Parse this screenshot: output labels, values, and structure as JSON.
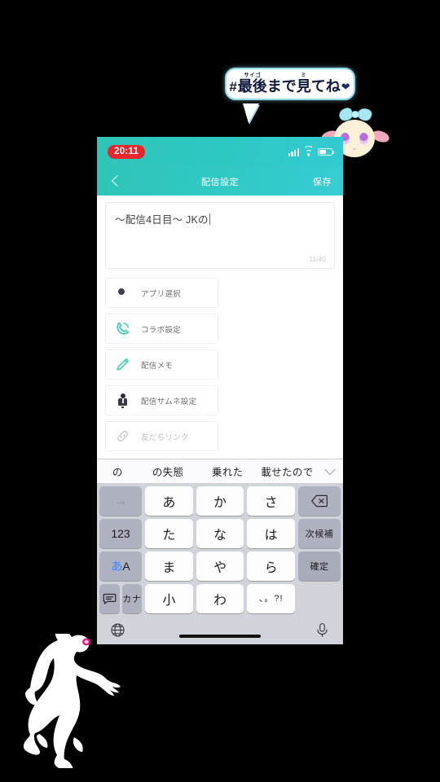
{
  "overlay": {
    "bubble": {
      "hash": "#",
      "ruby1_text": "サイゴ",
      "base1": "最後",
      "mid": "まで",
      "ruby2_text": "ミ",
      "base2": "見",
      "tail_text": "てね",
      "heart": "❤"
    },
    "mascot_name": "sheep-mascot",
    "dancer_name": "dancing-silhouette"
  },
  "phone": {
    "statusbar": {
      "time": "20:11",
      "signal_icon": "signal-bars-icon",
      "wifi_icon": "wifi-icon",
      "battery_icon": "battery-icon"
    },
    "navbar": {
      "back_icon": "chevron-left-icon",
      "title": "配信設定",
      "save_label": "保存"
    },
    "title_input": {
      "value": "〜配信4日目〜 JKの",
      "counter": "11/40"
    },
    "menu": [
      {
        "label": "アプリ選択",
        "icon": "app-select-icon",
        "dim": false
      },
      {
        "label": "コラボ設定",
        "icon": "phone-collab-icon",
        "dim": false
      },
      {
        "label": "配信メモ",
        "icon": "pencil-memo-icon",
        "dim": false
      },
      {
        "label": "配信サムネ設定",
        "icon": "thumbnail-person-icon",
        "dim": false
      },
      {
        "label": "友だちリンク",
        "icon": "link-chain-icon",
        "dim": true
      }
    ]
  },
  "keyboard": {
    "suggestions": [
      {
        "text": "の",
        "wide": false
      },
      {
        "text": "の失態",
        "wide": true
      },
      {
        "text": "乗れた",
        "wide": true
      },
      {
        "text": "載せたので",
        "wide": true
      }
    ],
    "expand_icon": "chevron-down-icon",
    "rows": [
      {
        "left": "→",
        "left_type": "arrow",
        "keys": [
          "あ",
          "か",
          "さ"
        ],
        "right": "⌫",
        "right_type": "delete"
      },
      {
        "left": "123",
        "left_type": "num",
        "keys": [
          "た",
          "な",
          "は"
        ],
        "right": "次候補",
        "right_type": "sm"
      },
      {
        "left": "あA",
        "left_type": "aa",
        "keys": [
          "ま",
          "や",
          "ら"
        ],
        "right": "確定",
        "right_type": "enter"
      },
      {
        "left": "カナ",
        "left_type": "kana",
        "left_extra": "keyboard-switch-icon",
        "keys": [
          "小",
          "わ",
          "、。?!"
        ],
        "right": "",
        "right_type": "none"
      }
    ],
    "bottom": {
      "globe_icon": "globe-icon",
      "mic_icon": "microphone-icon",
      "home_indicator": "home-indicator"
    }
  }
}
